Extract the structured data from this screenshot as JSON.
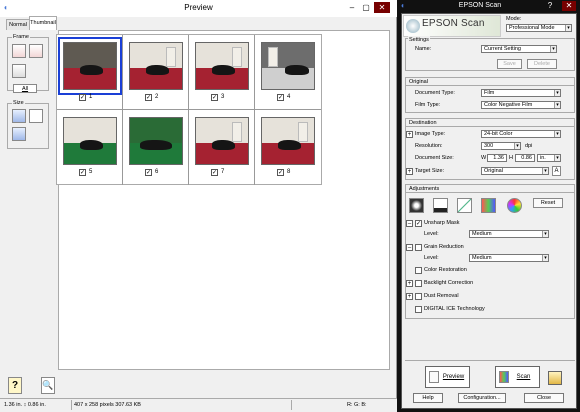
{
  "preview": {
    "title": "Preview",
    "tabs": [
      "Normal",
      "Thumbnail"
    ],
    "frame_label": "Frame",
    "all_button": "All",
    "size_label": "Size",
    "thumbnails": [
      {
        "number": "1",
        "checked": "✓"
      },
      {
        "number": "2",
        "checked": "✓"
      },
      {
        "number": "3",
        "checked": "✓"
      },
      {
        "number": "4",
        "checked": "✓"
      },
      {
        "number": "5",
        "checked": "✓"
      },
      {
        "number": "6",
        "checked": "✓"
      },
      {
        "number": "7",
        "checked": "✓"
      },
      {
        "number": "8",
        "checked": "✓"
      }
    ],
    "status": {
      "dims": "1.36 in. ↕ 0.86 in.",
      "pixels": "407 x 258 pixels 307.63 KB",
      "rgb": "R: G: B:"
    }
  },
  "epson": {
    "title": "EPSON Scan",
    "logo": "EPSON Scan",
    "mode_label": "Mode:",
    "mode_value": "Professional Mode",
    "settings": {
      "section": "Settings",
      "name_label": "Name:",
      "name_value": "Current Setting",
      "save": "Save",
      "delete": "Delete"
    },
    "original": {
      "section": "Original",
      "doc_type_label": "Document Type:",
      "doc_type_value": "Film",
      "film_type_label": "Film Type:",
      "film_type_value": "Color Negative Film"
    },
    "destination": {
      "section": "Destination",
      "image_type_label": "Image Type:",
      "image_type_value": "24-bit Color",
      "resolution_label": "Resolution:",
      "resolution_value": "300",
      "resolution_unit": "dpi",
      "doc_size_label": "Document Size:",
      "w_label": "W",
      "w_value": "1.36",
      "h_label": "H",
      "h_value": "0.86",
      "unit_value": "in.",
      "target_size_label": "Target Size:",
      "target_size_value": "Original",
      "a_icon": "A"
    },
    "adjustments": {
      "section": "Adjustments",
      "reset": "Reset",
      "unsharp_mask": "Unsharp Mask",
      "unsharp_level_label": "Level:",
      "unsharp_level_value": "Medium",
      "grain_reduction": "Grain Reduction",
      "grain_level_label": "Level:",
      "grain_level_value": "Medium",
      "color_restoration": "Color Restoration",
      "backlight_correction": "Backlight Correction",
      "dust_removal": "Dust Removal",
      "digital_ice": "DIGITAL ICE Technology"
    },
    "buttons": {
      "preview": "Preview",
      "scan": "Scan",
      "help": "Help",
      "configuration": "Configuration...",
      "close": "Close"
    }
  }
}
